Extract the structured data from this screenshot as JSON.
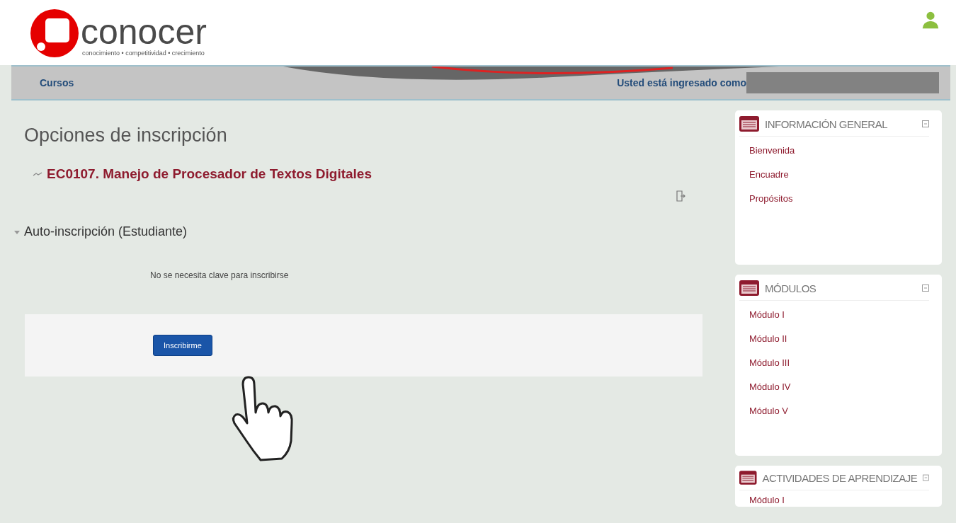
{
  "header": {
    "logo_text": "conocer",
    "tagline": "conocimiento • competitividad • crecimiento"
  },
  "navbar": {
    "link": "Cursos",
    "login_text": "Usted está ingresado como"
  },
  "page": {
    "title": "Opciones de inscripción",
    "course": "EC0107. Manejo de Procesador de Textos Digitales",
    "section": {
      "title": "Auto-inscripción (Estudiante)",
      "expanded": true,
      "note": "No se necesita clave para inscribirse",
      "button": "Inscribirme"
    }
  },
  "blocks": [
    {
      "title": "INFORMACIÓN GENERAL",
      "items": [
        "Bienvenida",
        "Encuadre",
        "Propósitos"
      ]
    },
    {
      "title": "MÓDULOS",
      "items": [
        "Módulo I",
        "Módulo II",
        "Módulo III",
        "Módulo IV",
        "Módulo V"
      ]
    },
    {
      "title": "ACTIVIDADES DE APRENDIZAJE",
      "items": [
        "Módulo I"
      ]
    }
  ]
}
